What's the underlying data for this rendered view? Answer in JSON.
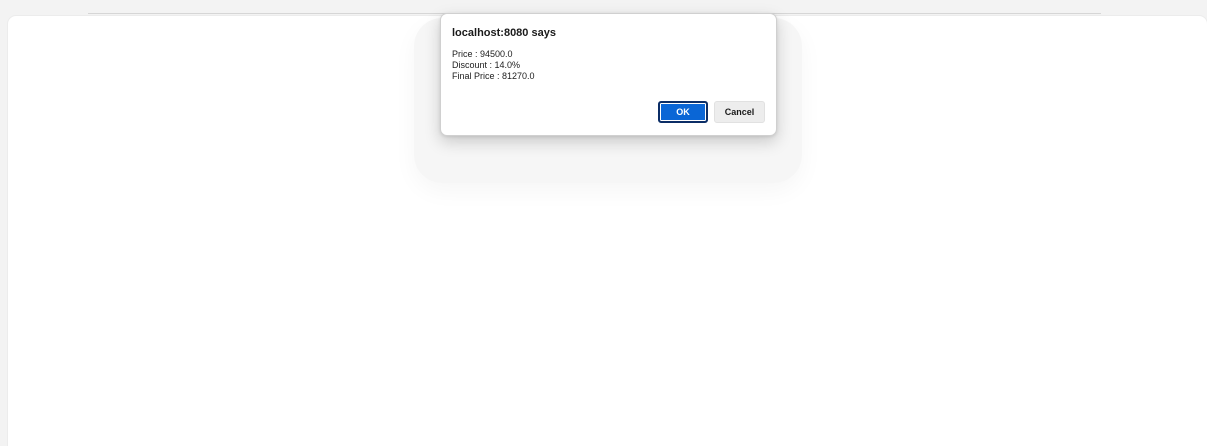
{
  "dialog": {
    "title": "localhost:8080 says",
    "message_lines": [
      "Price : 94500.0",
      "Discount : 14.0%",
      "Final Price : 81270.0"
    ],
    "ok_label": "OK",
    "cancel_label": "Cancel"
  },
  "colors": {
    "ok_button": "#0a66d6",
    "cancel_button": "#ededed",
    "page_background": "#ffffff"
  }
}
